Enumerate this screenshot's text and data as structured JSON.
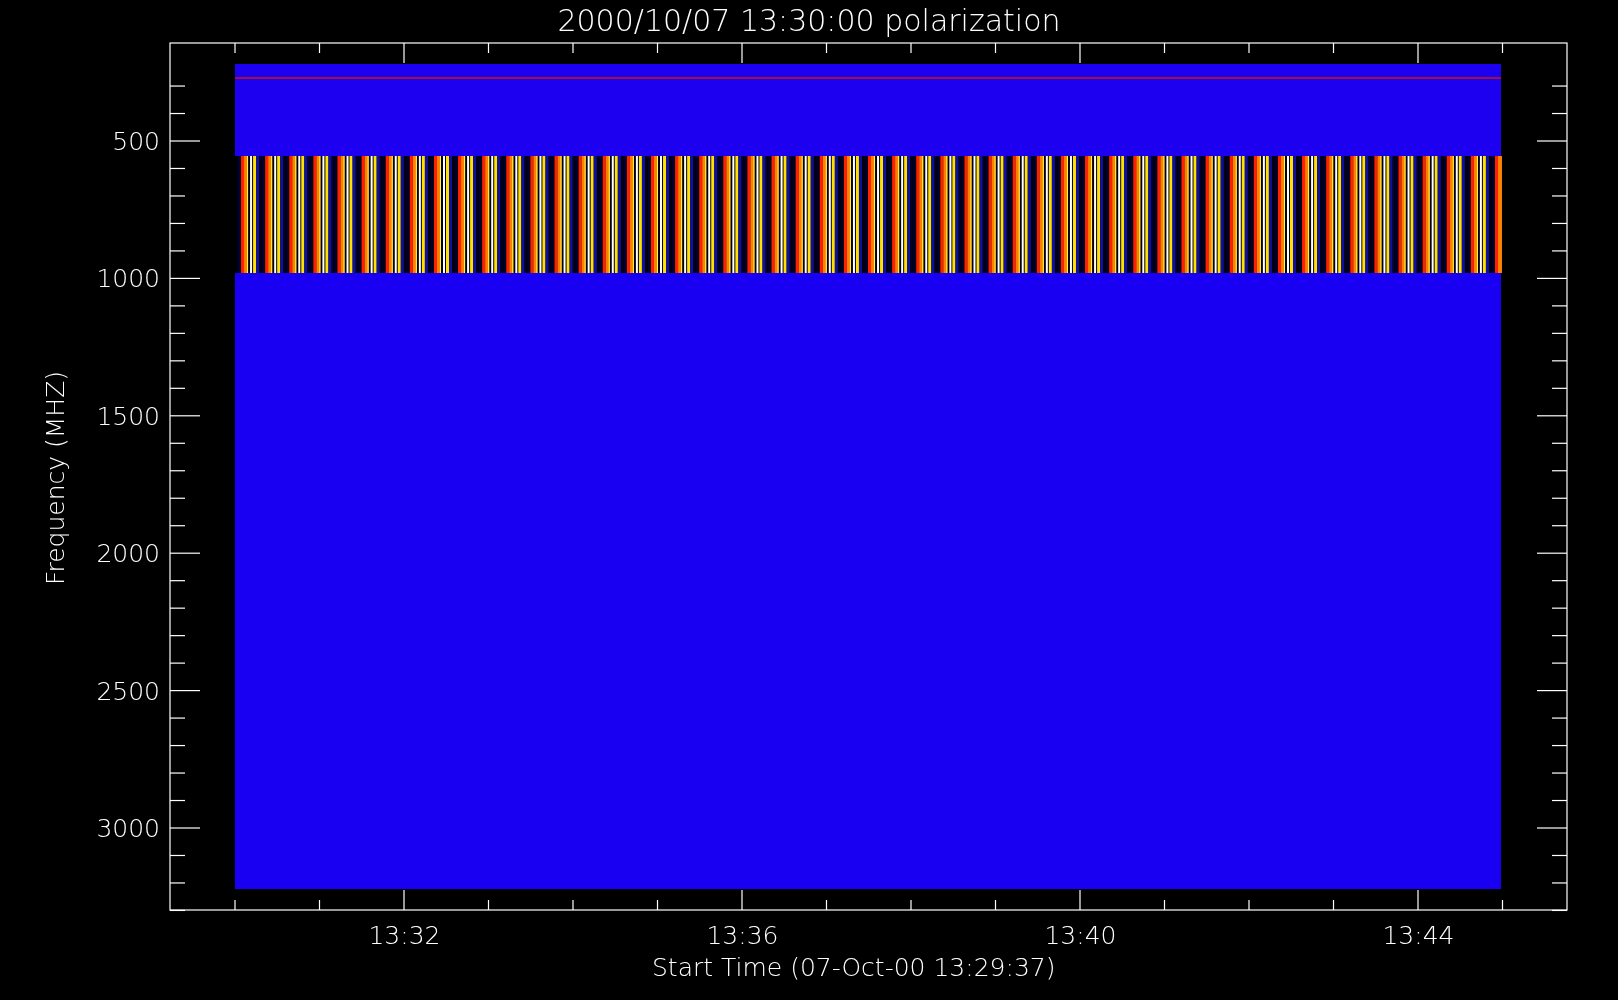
{
  "title": "2000/10/07 13:30:00 polarization",
  "xlabel": "Start Time (07-Oct-00 13:29:37)",
  "ylabel": "Frequency (MHZ)",
  "xticks": [
    "13:32",
    "13:36",
    "13:40",
    "13:44"
  ],
  "yticks": [
    "500",
    "1000",
    "1500",
    "2000",
    "2500",
    "3000"
  ]
}
